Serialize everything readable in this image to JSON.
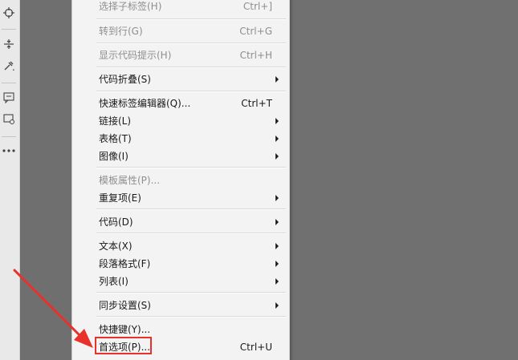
{
  "menu": {
    "items": [
      {
        "label": "选择子标签(H)",
        "shortcut": "Ctrl+]",
        "disabled": true
      },
      {
        "label": "转到行(G)",
        "shortcut": "Ctrl+G",
        "disabled": true
      },
      {
        "label": "显示代码提示(H)",
        "shortcut": "Ctrl+H",
        "disabled": true
      },
      {
        "label": "代码折叠(S)",
        "submenu": true
      },
      {
        "label": "快速标签编辑器(Q)...",
        "shortcut": "Ctrl+T"
      },
      {
        "label": "链接(L)",
        "submenu": true
      },
      {
        "label": "表格(T)",
        "submenu": true
      },
      {
        "label": "图像(I)",
        "submenu": true
      },
      {
        "label": "模板属性(P)...",
        "disabled": true
      },
      {
        "label": "重复项(E)",
        "submenu": true
      },
      {
        "label": "代码(D)",
        "submenu": true
      },
      {
        "label": "文本(X)",
        "submenu": true
      },
      {
        "label": "段落格式(F)",
        "submenu": true
      },
      {
        "label": "列表(I)",
        "submenu": true
      },
      {
        "label": "同步设置(S)",
        "submenu": true
      },
      {
        "label": "快捷键(Y)..."
      },
      {
        "label": "首选项(P)...",
        "shortcut": "Ctrl+U",
        "highlighted": true
      }
    ]
  },
  "colors": {
    "annotation": "#e8312b",
    "background": "#707070",
    "menu_bg": "#f3f3f3",
    "disabled_text": "#8e8e8e"
  },
  "toolbar": {
    "icons": [
      "target-icon",
      "split-icon",
      "eyedropper-icon",
      "comment-icon",
      "comment-settings-icon",
      "more-icon"
    ]
  }
}
